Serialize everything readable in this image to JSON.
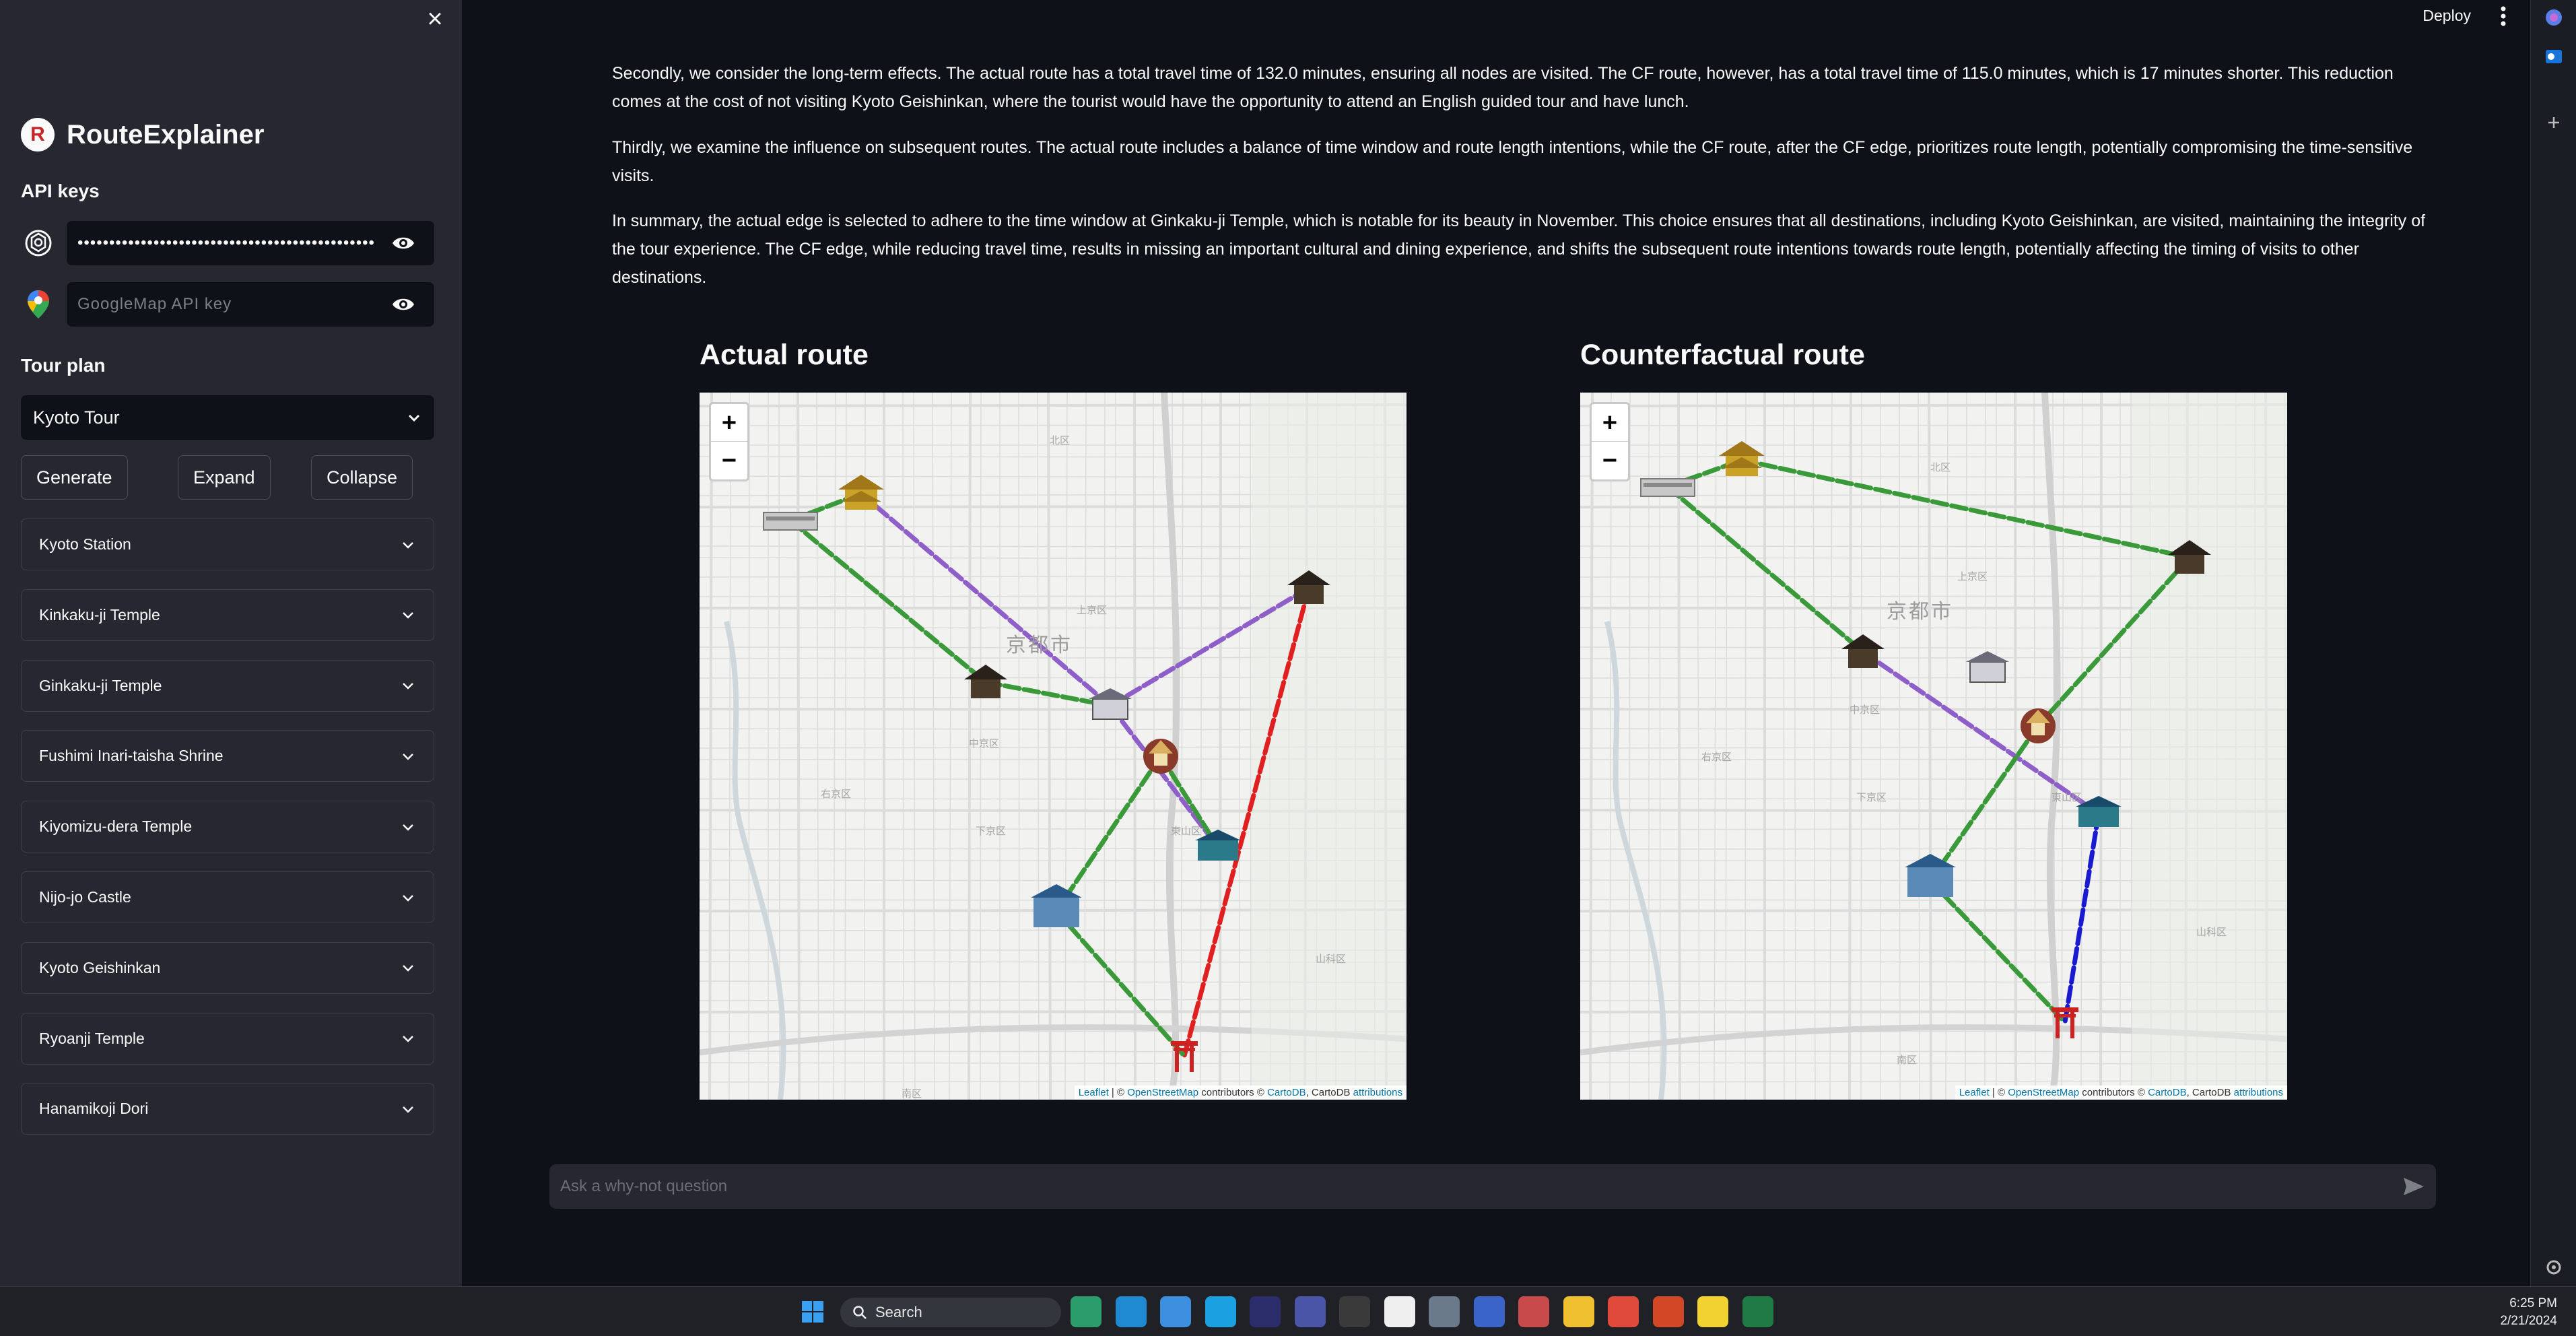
{
  "sidebar": {
    "close_glyph": "×",
    "app_title": "RouteExplainer",
    "logo_letter": "R",
    "api_keys_label": "API keys",
    "openai_key_value": "••••••••••••••••••••••••••••••••••••••••••••••••••••",
    "google_key_placeholder": "GoogleMap API key",
    "tour_plan_label": "Tour plan",
    "tour_select_value": "Kyoto Tour",
    "buttons": {
      "generate": "Generate",
      "expand": "Expand",
      "collapse": "Collapse"
    },
    "destinations": [
      "Kyoto Station",
      "Kinkaku-ji Temple",
      "Ginkaku-ji Temple",
      "Fushimi Inari-taisha Shrine",
      "Kiyomizu-dera Temple",
      "Nijo-jo Castle",
      "Kyoto Geishinkan",
      "Ryoanji Temple",
      "Hanamikoji Dori"
    ]
  },
  "header": {
    "deploy_label": "Deploy"
  },
  "explanation": {
    "paragraphs": [
      "Secondly, we consider the long-term effects. The actual route has a total travel time of 132.0 minutes, ensuring all nodes are visited. The CF route, however, has a total travel time of 115.0 minutes, which is 17 minutes shorter. This reduction comes at the cost of not visiting Kyoto Geishinkan, where the tourist would have the opportunity to attend an English guided tour and have lunch.",
      "Thirdly, we examine the influence on subsequent routes. The actual route includes a balance of time window and route length intentions, while the CF route, after the CF edge, prioritizes route length, potentially compromising the time-sensitive visits.",
      "In summary, the actual edge is selected to adhere to the time window at Ginkaku-ji Temple, which is notable for its beauty in November. This choice ensures that all destinations, including Kyoto Geishinkan, are visited, maintaining the integrity of the tour experience. The CF edge, while reducing travel time, results in missing an important cultural and dining experience, and shifts the subsequent route intentions towards route length, potentially affecting the timing of visits to other destinations."
    ]
  },
  "maps": {
    "actual": {
      "title": "Actual route"
    },
    "counterfactual": {
      "title": "Counterfactual route"
    },
    "city_label": "京都市",
    "zoom_in": "+",
    "zoom_out": "−",
    "attribution": {
      "leaflet": "Leaflet",
      "sep1": " | © ",
      "osm": "OpenStreetMap",
      "mid": " contributors © ",
      "carto": "CartoDB",
      "mid2": ", CartoDB ",
      "attr": "attributions"
    },
    "district_labels": [
      "北区",
      "上京区",
      "中京区",
      "右京区",
      "下京区",
      "東山区",
      "南区",
      "山科区"
    ],
    "route_colors": {
      "time_window": "#8e5fc8",
      "route_length": "#3a9a3a",
      "actual_edge": "#e02020",
      "cf_edge": "#1a1ad0"
    }
  },
  "chat": {
    "placeholder": "Ask a why-not question"
  },
  "taskbar": {
    "search_label": "Search",
    "time": "6:25 PM",
    "date": "2/21/2024"
  }
}
